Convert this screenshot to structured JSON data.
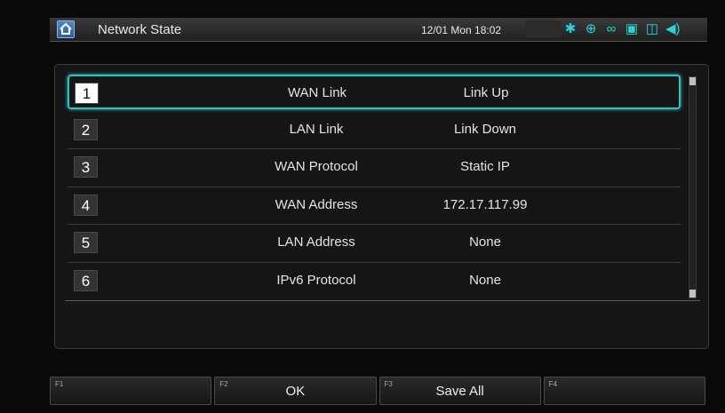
{
  "header": {
    "title": "Network State",
    "datetime": "12/01 Mon 18:02",
    "status_icons": [
      "settings-gear-icon",
      "globe-network-icon",
      "link-chain-icon",
      "storage-card-icon",
      "display-icon",
      "speaker-volume-icon"
    ]
  },
  "rows": [
    {
      "num": "1",
      "label": "WAN Link",
      "value": "Link Up"
    },
    {
      "num": "2",
      "label": "LAN Link",
      "value": "Link Down"
    },
    {
      "num": "3",
      "label": "WAN Protocol",
      "value": "Static IP"
    },
    {
      "num": "4",
      "label": "WAN Address",
      "value": "172.17.117.99"
    },
    {
      "num": "5",
      "label": "LAN Address",
      "value": "None"
    },
    {
      "num": "6",
      "label": "IPv6 Protocol",
      "value": "None"
    }
  ],
  "selected_row": 1,
  "fkeys": [
    {
      "tag": "F1",
      "label": ""
    },
    {
      "tag": "F2",
      "label": "OK"
    },
    {
      "tag": "F3",
      "label": "Save All"
    },
    {
      "tag": "F4",
      "label": ""
    }
  ],
  "colors": {
    "accent": "#2ec3c3",
    "icon": "#29d3d6",
    "home": "#3b74b8"
  }
}
